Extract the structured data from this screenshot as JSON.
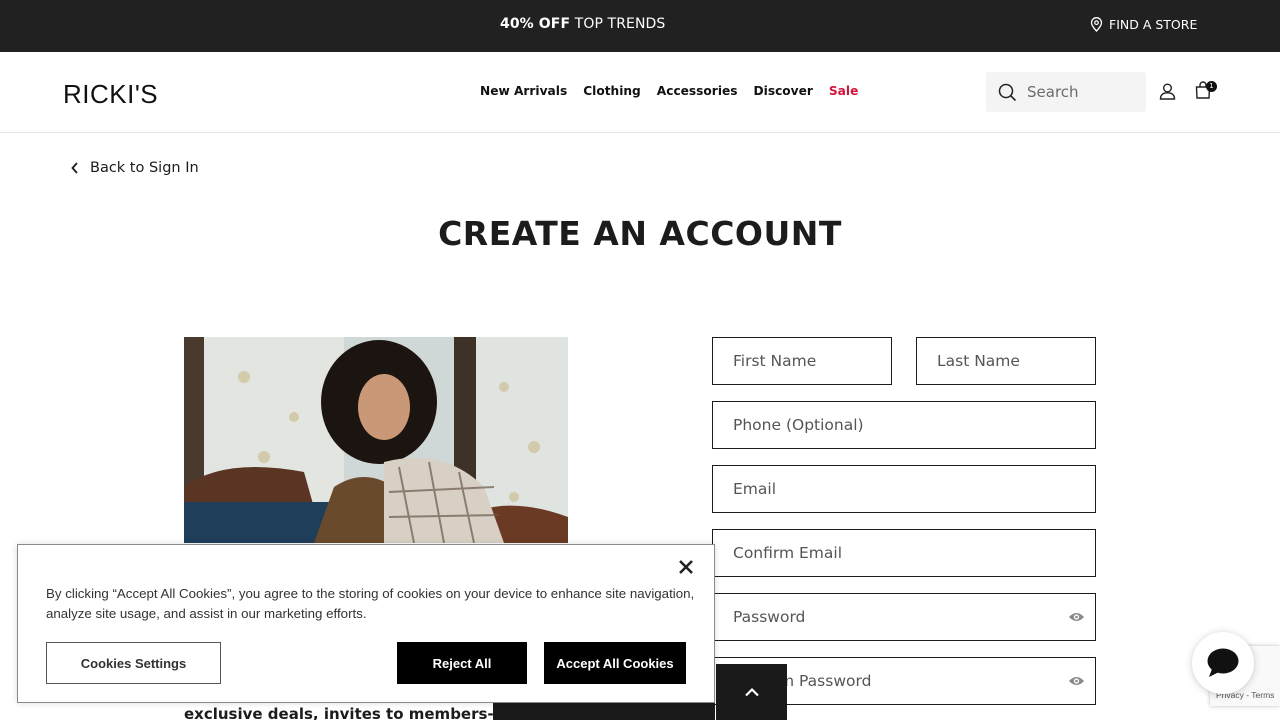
{
  "promo": {
    "bold": "40% OFF",
    "rest": " TOP TRENDS",
    "find_store": "FIND A STORE"
  },
  "header": {
    "logo": "RICKI'S",
    "nav": [
      "New Arrivals",
      "Clothing",
      "Accessories",
      "Discover",
      "Sale"
    ],
    "search_placeholder": "Search",
    "cart_count": "1"
  },
  "back_link": "Back to Sign In",
  "page_title": "CREATE AN ACCOUNT",
  "form": {
    "first_name": "First Name",
    "last_name": "Last Name",
    "phone": "Phone (Optional)",
    "email": "Email",
    "confirm_email": "Confirm Email",
    "password": "Password",
    "confirm_password": "Confirm Password"
  },
  "promo_copy": "exclusive deals, invites to members-on",
  "cookie": {
    "text": "By clicking “Accept All Cookies”, you agree to the storing of cookies on your device to enhance site navigation, analyze site usage, and assist in our marketing efforts.",
    "settings": "Cookies Settings",
    "reject": "Reject All",
    "accept": "Accept All Cookies"
  },
  "recaptcha": "Privacy - Terms",
  "colors": {
    "promo_bar": "#212121",
    "sale": "#d2143a",
    "button": "#000000"
  }
}
